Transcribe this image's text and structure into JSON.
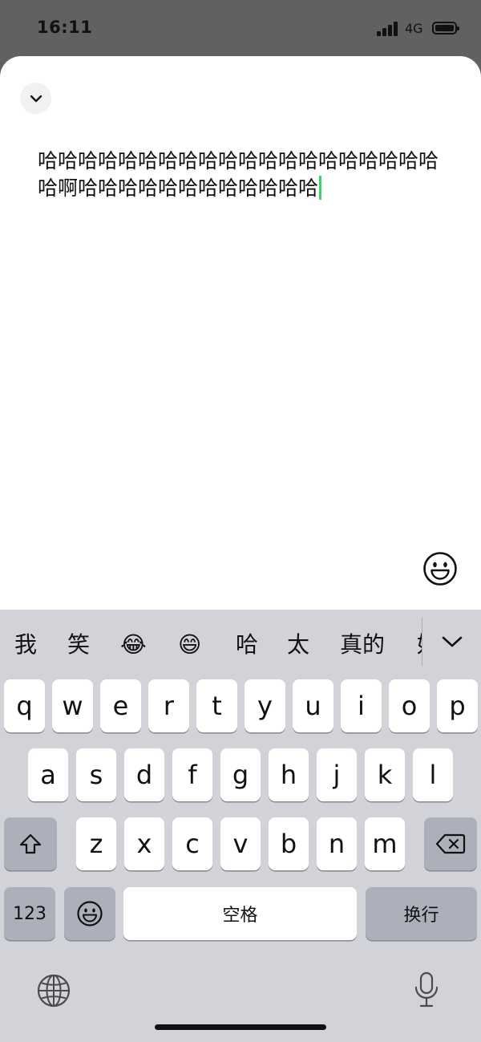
{
  "status_bar": {
    "time": "16:11",
    "network": "4G"
  },
  "editor": {
    "text": "哈哈哈哈哈哈哈哈哈哈哈哈哈哈哈哈哈哈哈哈哈啊哈哈哈哈哈哈哈哈哈哈哈哈"
  },
  "keyboard": {
    "candidates": [
      "我",
      "笑",
      "😂",
      "😄",
      "哈",
      "太",
      "真的",
      "好"
    ],
    "rows": [
      [
        "q",
        "w",
        "e",
        "r",
        "t",
        "y",
        "u",
        "i",
        "o",
        "p"
      ],
      [
        "a",
        "s",
        "d",
        "f",
        "g",
        "h",
        "j",
        "k",
        "l"
      ],
      [
        "z",
        "x",
        "c",
        "v",
        "b",
        "n",
        "m"
      ]
    ],
    "numbers_label": "123",
    "space_label": "空格",
    "return_label": "换行"
  },
  "icons": {
    "collapse": "chevron-down-icon",
    "emoji": "smiley-icon",
    "candidates_expand": "chevron-down-icon",
    "shift": "shift-icon",
    "delete": "backspace-icon",
    "emoji_key": "smiley-icon",
    "globe": "globe-icon",
    "dictation": "microphone-icon"
  },
  "colors": {
    "caret": "#3fd16b",
    "keyboard_bg": "#d1d3d9"
  }
}
